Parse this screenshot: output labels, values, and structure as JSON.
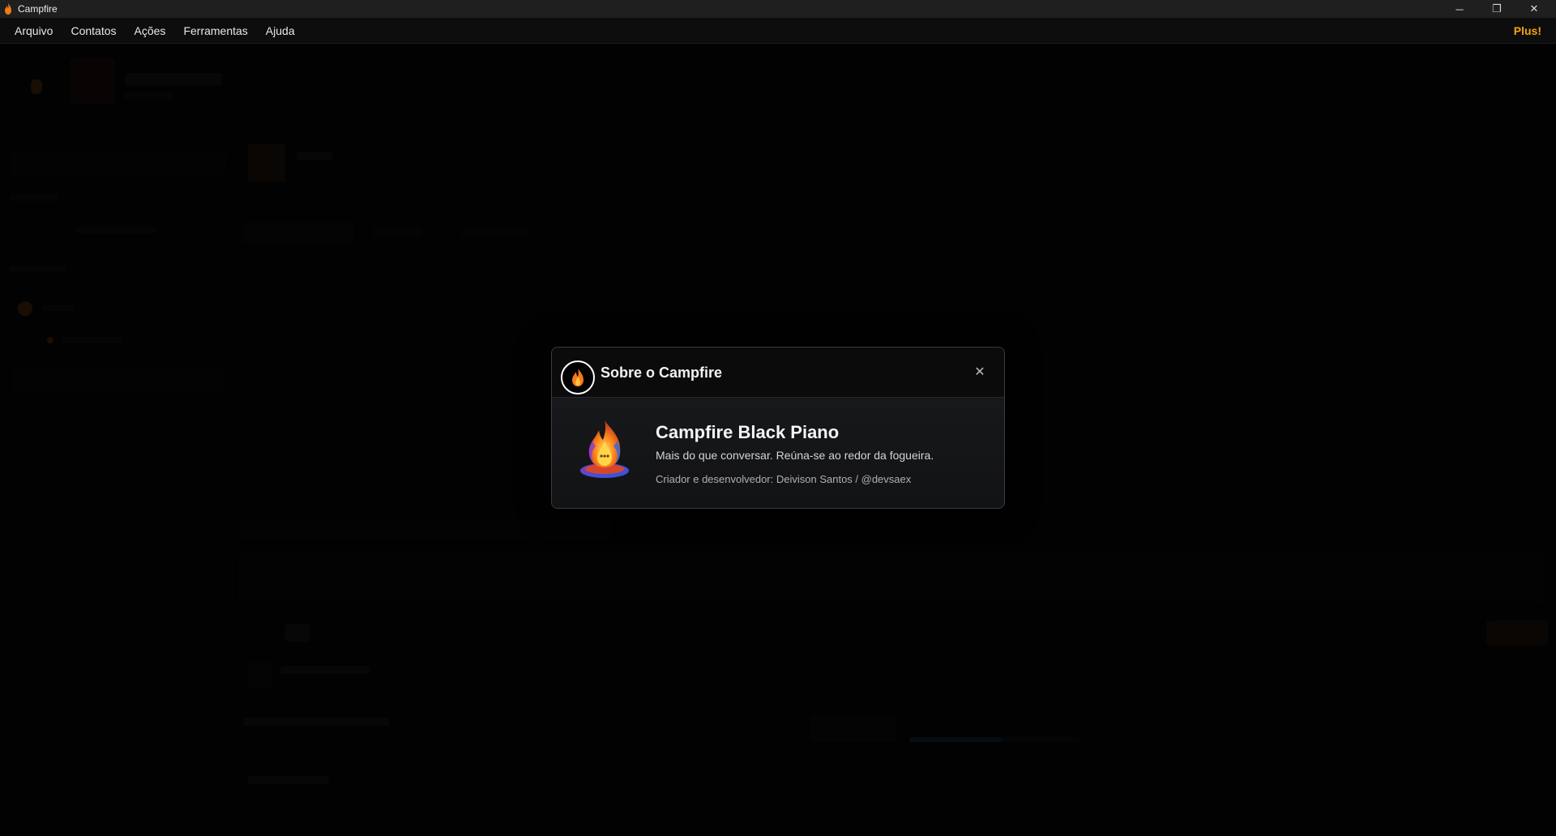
{
  "window": {
    "title": "Campfire"
  },
  "window_controls": {
    "minimize": "─",
    "restore": "❐",
    "close": "✕"
  },
  "menu": {
    "items": [
      "Arquivo",
      "Contatos",
      "Ações",
      "Ferramentas",
      "Ajuda"
    ],
    "plus_label": "Plus!"
  },
  "modal": {
    "title": "Sobre o Campfire",
    "close_glyph": "✕",
    "product_name": "Campfire Black Piano",
    "tagline": "Mais do que conversar. Reúna-se ao redor da fogueira.",
    "credits": "Criador e desenvolvedor: Deivison Santos / @devsaex"
  },
  "colors": {
    "accent": "#f2a413",
    "modal_bg": "#141517",
    "titlebar_bg": "#1f1f1f"
  },
  "icons": {
    "app": "campfire-flame-icon",
    "modal_header": "campfire-flame-icon",
    "logo": "campfire-logo",
    "close": "close-icon"
  }
}
